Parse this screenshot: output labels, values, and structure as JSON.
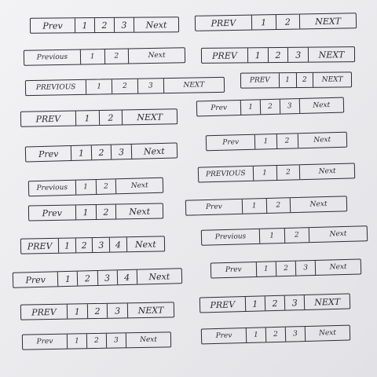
{
  "sketch": {
    "widgets": [
      {
        "items": [
          "Prev",
          "1",
          "2",
          "3",
          "Next"
        ]
      },
      {
        "items": [
          "PREV",
          "1",
          "2",
          "NEXT"
        ]
      },
      {
        "items": [
          "Previous",
          "1",
          "2",
          "Next"
        ]
      },
      {
        "items": [
          "PREV",
          "1",
          "2",
          "3",
          "NEXT"
        ]
      },
      {
        "items": [
          "PREVIOUS",
          "1",
          "2",
          "3",
          "NEXT"
        ]
      },
      {
        "items": [
          "PREV",
          "1",
          "2",
          "NEXT"
        ]
      },
      {
        "items": [
          "PREV",
          "1",
          "2",
          "NEXT"
        ]
      },
      {
        "items": [
          "Prev",
          "1",
          "2",
          "3",
          "Next"
        ]
      },
      {
        "items": [
          "Prev",
          "1",
          "2",
          "3",
          "Next"
        ]
      },
      {
        "items": [
          "Prev",
          "1",
          "2",
          "Next"
        ]
      },
      {
        "items": [
          "PREVIOUS",
          "1",
          "2",
          "Next"
        ]
      },
      {
        "items": [
          "Previous",
          "1",
          "2",
          "Next"
        ]
      },
      {
        "items": [
          "Prev",
          "1",
          "2",
          "Next"
        ]
      },
      {
        "items": [
          "Prev",
          "1",
          "2",
          "Next"
        ]
      },
      {
        "items": [
          "PREV",
          "1",
          "2",
          "3",
          "4",
          "Next"
        ]
      },
      {
        "items": [
          "Previous",
          "1",
          "2",
          "Next"
        ]
      },
      {
        "items": [
          "Prev",
          "1",
          "2",
          "3",
          "4",
          "Next"
        ]
      },
      {
        "items": [
          "Prev",
          "1",
          "2",
          "3",
          "Next"
        ]
      },
      {
        "items": [
          "PREV",
          "1",
          "2",
          "3",
          "NEXT"
        ]
      },
      {
        "items": [
          "PREV",
          "1",
          "2",
          "3",
          "NEXT"
        ]
      },
      {
        "items": [
          "Prev",
          "1",
          "2",
          "3",
          "Next"
        ]
      },
      {
        "items": [
          "Prev",
          "1",
          "2",
          "3",
          "Next"
        ]
      }
    ]
  }
}
